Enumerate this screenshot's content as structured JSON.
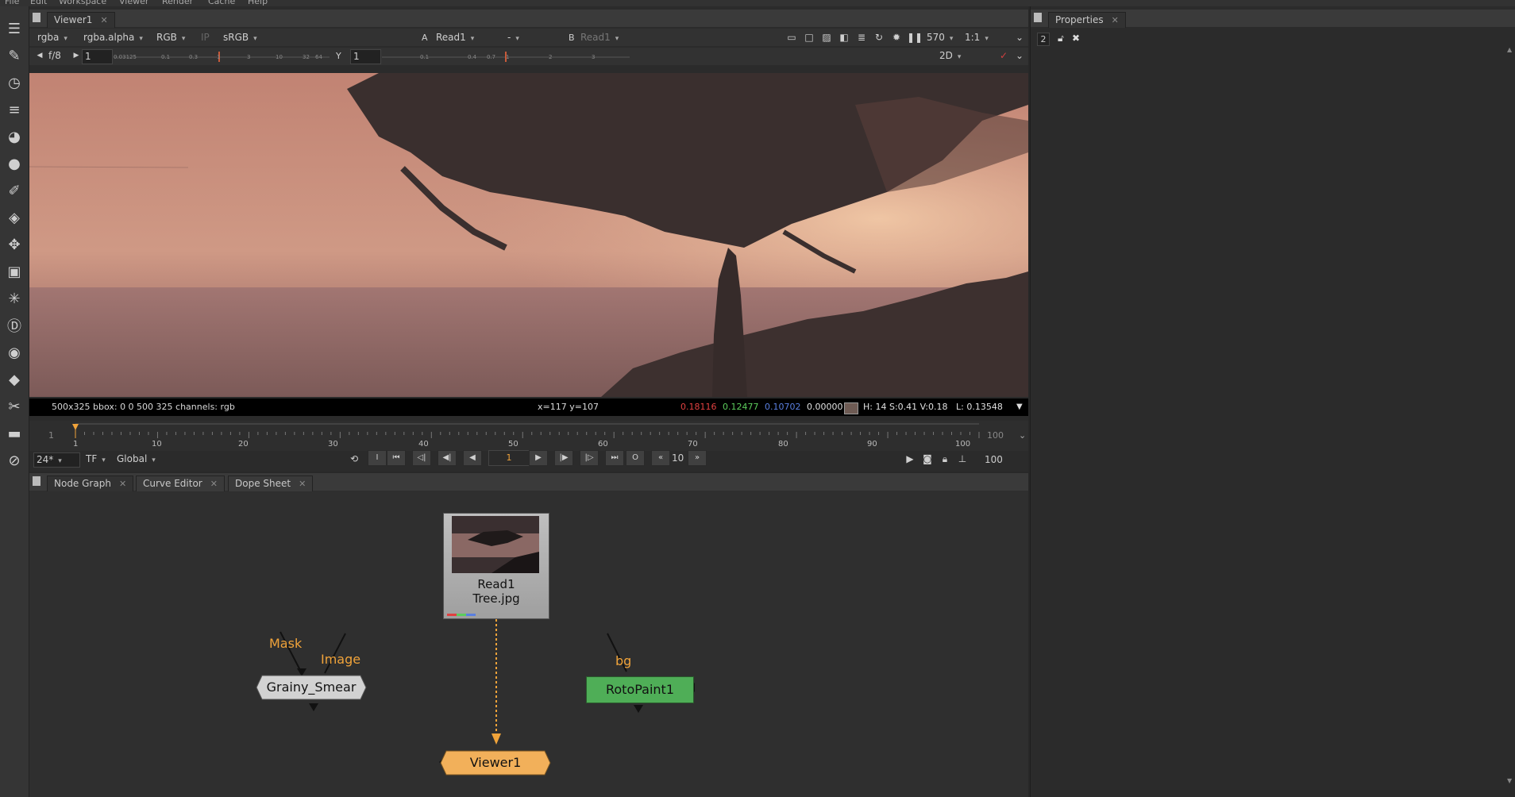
{
  "menu": [
    "File",
    "Edit",
    "Workspace",
    "Viewer",
    "Render",
    "Cache",
    "Help"
  ],
  "toolbar_icons": [
    "menu-icon",
    "pen-icon",
    "clock-icon",
    "bars-icon",
    "palette-icon",
    "circle-icon",
    "draw-icon",
    "layers-icon",
    "move-icon",
    "cube-icon",
    "particles-icon",
    "deep-icon",
    "eye-icon",
    "tag-icon",
    "wrench-icon",
    "film-icon",
    "nuke-icon"
  ],
  "viewer": {
    "tab_label": "Viewer1",
    "channels": "rgba",
    "alpha": "rgba.alpha",
    "rgb": "RGB",
    "ip": "IP",
    "lut": "sRGB",
    "a_label": "A",
    "a_input": "Read1",
    "wipe": "-",
    "b_label": "B",
    "b_input": "Read1",
    "zoom": "570",
    "ratio": "1:1",
    "fstop": "f/8",
    "gain": "1",
    "gamma_label": "Y",
    "gamma": "1",
    "view_mode": "2D",
    "gain_ticks": [
      "0.03125",
      "0.1",
      "0.3",
      "1",
      "3",
      "10",
      "32",
      "64"
    ],
    "gamma_ticks": [
      "0.1",
      "0.4",
      "0.7",
      "1",
      "2",
      "3"
    ]
  },
  "status": {
    "format": "500x325  bbox: 0 0 500 325 channels: rgb",
    "coords": "x=117 y=107",
    "r": "0.18116",
    "g": "0.12477",
    "b": "0.10702",
    "a": "0.00000",
    "swatch": "#6e5b54",
    "hsv": "H: 14 S:0.41 V:0.18",
    "lum": "L: 0.13548"
  },
  "timeline": {
    "start": "1",
    "end": "100",
    "end_field": "100",
    "ticks": [
      "1",
      "10",
      "20",
      "30",
      "40",
      "50",
      "60",
      "70",
      "80",
      "90",
      "100"
    ],
    "fps": "24*",
    "tf": "TF",
    "scope": "Global",
    "current_frame": "1",
    "step": "10",
    "in_label": "I",
    "out_label": "O"
  },
  "nodegraph": {
    "tabs": [
      {
        "label": "Node Graph"
      },
      {
        "label": "Curve Editor"
      },
      {
        "label": "Dope Sheet"
      }
    ],
    "read_node": {
      "name": "Read1",
      "file": "Tree.jpg"
    },
    "grainy_node": {
      "name": "Grainy_Smear",
      "input_mask": "Mask",
      "input_image": "Image"
    },
    "roto_node": {
      "name": "RotoPaint1",
      "input_bg": "bg"
    },
    "viewer_node": {
      "name": "Viewer1"
    }
  },
  "properties": {
    "tab_label": "Properties",
    "count": "2"
  },
  "colors": {
    "accent": "#f0a33a",
    "roto_green": "#4fae57",
    "viewer_orange": "#f2b05a",
    "red_channel": "#e04040",
    "green_channel": "#5ccc5c",
    "blue_channel": "#5a7fe0"
  }
}
